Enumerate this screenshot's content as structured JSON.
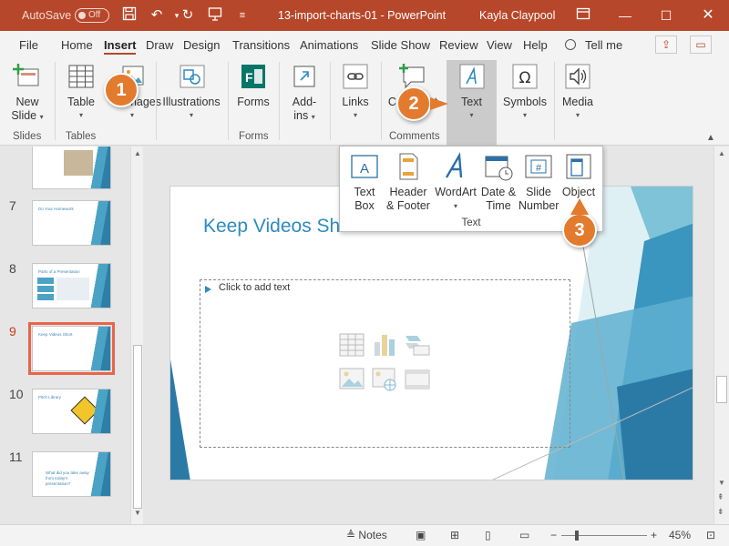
{
  "titlebar": {
    "autosave_label": "AutoSave",
    "autosave_state": "Off",
    "doc_title": "13-import-charts-01  -  PowerPoint",
    "user": "Kayla Claypool"
  },
  "tabs": [
    "File",
    "Home",
    "Insert",
    "Draw",
    "Design",
    "Transitions",
    "Animations",
    "Slide Show",
    "Review",
    "View",
    "Help"
  ],
  "active_tab": "Insert",
  "tell_me": "Tell me",
  "ribbon": {
    "new_slide": "New",
    "new_slide2": "Slide",
    "table": "Table",
    "images": "Images",
    "illustrations": "Illustrations",
    "forms": "Forms",
    "addins": "Add-",
    "addins2": "ins",
    "links": "Links",
    "comment": "Comment",
    "text": "Text",
    "symbols": "Symbols",
    "media": "Media",
    "groups": {
      "slides": "Slides",
      "tables": "Tables",
      "forms": "Forms",
      "comments": "Comments"
    }
  },
  "dropdown": {
    "items": [
      {
        "l1": "Text",
        "l2": "Box"
      },
      {
        "l1": "Header",
        "l2": "& Footer"
      },
      {
        "l1": "WordArt",
        "l2": ""
      },
      {
        "l1": "Date &",
        "l2": "Time"
      },
      {
        "l1": "Slide",
        "l2": "Number"
      },
      {
        "l1": "Object",
        "l2": ""
      }
    ],
    "group_label": "Text"
  },
  "slides": [
    {
      "num": "7",
      "title": "Do Your Homework"
    },
    {
      "num": "8",
      "title": "Parts of a Presentation"
    },
    {
      "num": "9",
      "title": "Keep Videos Short"
    },
    {
      "num": "10",
      "title": "Pitch Library"
    },
    {
      "num": "11",
      "title": "What did you take away from today's presentation?"
    }
  ],
  "slide": {
    "title": "Keep Videos Short",
    "placeholder": "Click to add text"
  },
  "callouts": [
    "1",
    "2",
    "3"
  ],
  "status": {
    "notes": "Notes",
    "zoom": "45%"
  },
  "colors": {
    "accent": "#b7472a",
    "callout": "#e37b2e",
    "slide_title": "#2e8bc0"
  }
}
